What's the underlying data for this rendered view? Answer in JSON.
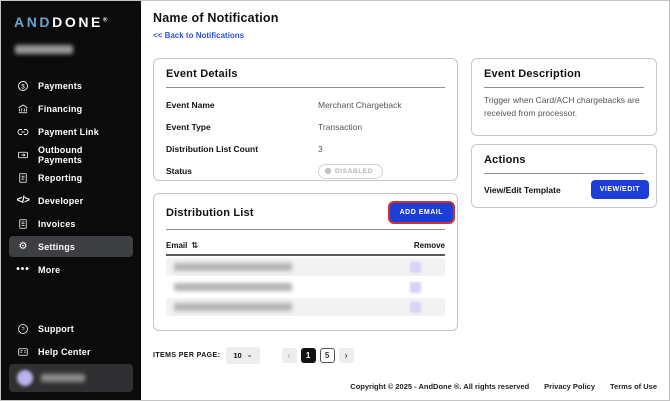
{
  "sidebar": {
    "logo": {
      "part1": "AND",
      "part2": "DONE",
      "reg": "®"
    },
    "items": [
      {
        "label": "Payments",
        "icon": "dollar-circle-icon"
      },
      {
        "label": "Financing",
        "icon": "bank-icon"
      },
      {
        "label": "Payment Link",
        "icon": "link-icon"
      },
      {
        "label": "Outbound Payments",
        "icon": "card-out-icon"
      },
      {
        "label": "Reporting",
        "icon": "report-icon"
      },
      {
        "label": "Developer",
        "icon": "code-icon",
        "code_glyph": "</>"
      },
      {
        "label": "Invoices",
        "icon": "invoice-icon"
      },
      {
        "label": "Settings",
        "icon": "gear-icon",
        "gear_glyph": "⚙",
        "active": true
      },
      {
        "label": "More",
        "icon": "ellipsis-icon",
        "dots_glyph": "•••"
      }
    ],
    "footer_items": [
      {
        "label": "Support",
        "icon": "help-circle-icon"
      },
      {
        "label": "Help Center",
        "icon": "help-center-icon"
      }
    ]
  },
  "header": {
    "title": "Name of Notification",
    "back_link": "<< Back to Notifications"
  },
  "event_details": {
    "title": "Event Details",
    "rows": [
      {
        "label": "Event Name",
        "value": "Merchant Chargeback"
      },
      {
        "label": "Event Type",
        "value": "Transaction"
      },
      {
        "label": "Distribution List Count",
        "value": "3"
      },
      {
        "label": "Status",
        "value": "DISABLED"
      }
    ]
  },
  "event_description": {
    "title": "Event Description",
    "text": "Trigger when Card/ACH chargebacks are received from processor."
  },
  "actions": {
    "title": "Actions",
    "row_label": "View/Edit Template",
    "button_label": "VIEW/EDIT"
  },
  "distribution_list": {
    "title": "Distribution List",
    "add_button_label": "ADD EMAIL",
    "columns": {
      "email": "Email",
      "remove": "Remove"
    },
    "sort_icon": "⇅",
    "rows_redacted_count": 3
  },
  "pagination": {
    "items_per_page_label": "ITEMS PER PAGE:",
    "items_per_page_value": "10",
    "dropdown_chevron": "⌄",
    "prev_icon": "‹",
    "next_icon": "›",
    "pages": [
      "1",
      "5"
    ],
    "current_page": "1"
  },
  "footer": {
    "copyright": "Copyright © 2025 - AndDone ®. All rights reserved",
    "links": [
      "Privacy Policy",
      "Terms of Use"
    ]
  },
  "colors": {
    "sidebar_bg": "#0b0b0c",
    "logo_accent": "#6aa3cb",
    "primary_button_blue": "#1d3ed6",
    "add_button_ring_red": "#d32f2f",
    "link_blue": "#2f55d4",
    "active_nav_bg": "#3d3f42",
    "row_stripe": "#f2f2f2",
    "remove_chip": "#d8d2f5"
  }
}
